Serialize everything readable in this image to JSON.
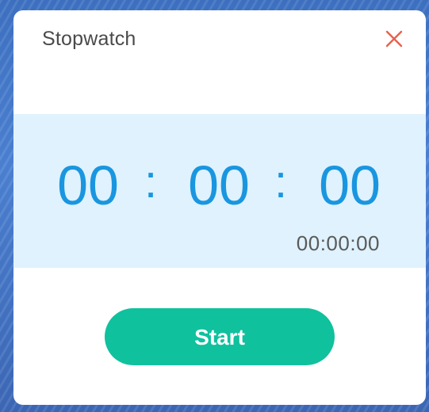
{
  "dialog": {
    "title": "Stopwatch",
    "close_icon": "close-icon",
    "close_color": "#e8614f"
  },
  "timer": {
    "hours": "00",
    "minutes": "00",
    "seconds": "00",
    "separator": ":",
    "elapsed_text": "00:00:00",
    "digit_color": "#1a96e0",
    "panel_color": "#dff2fd"
  },
  "controls": {
    "start_label": "Start",
    "start_color": "#10c19e"
  }
}
